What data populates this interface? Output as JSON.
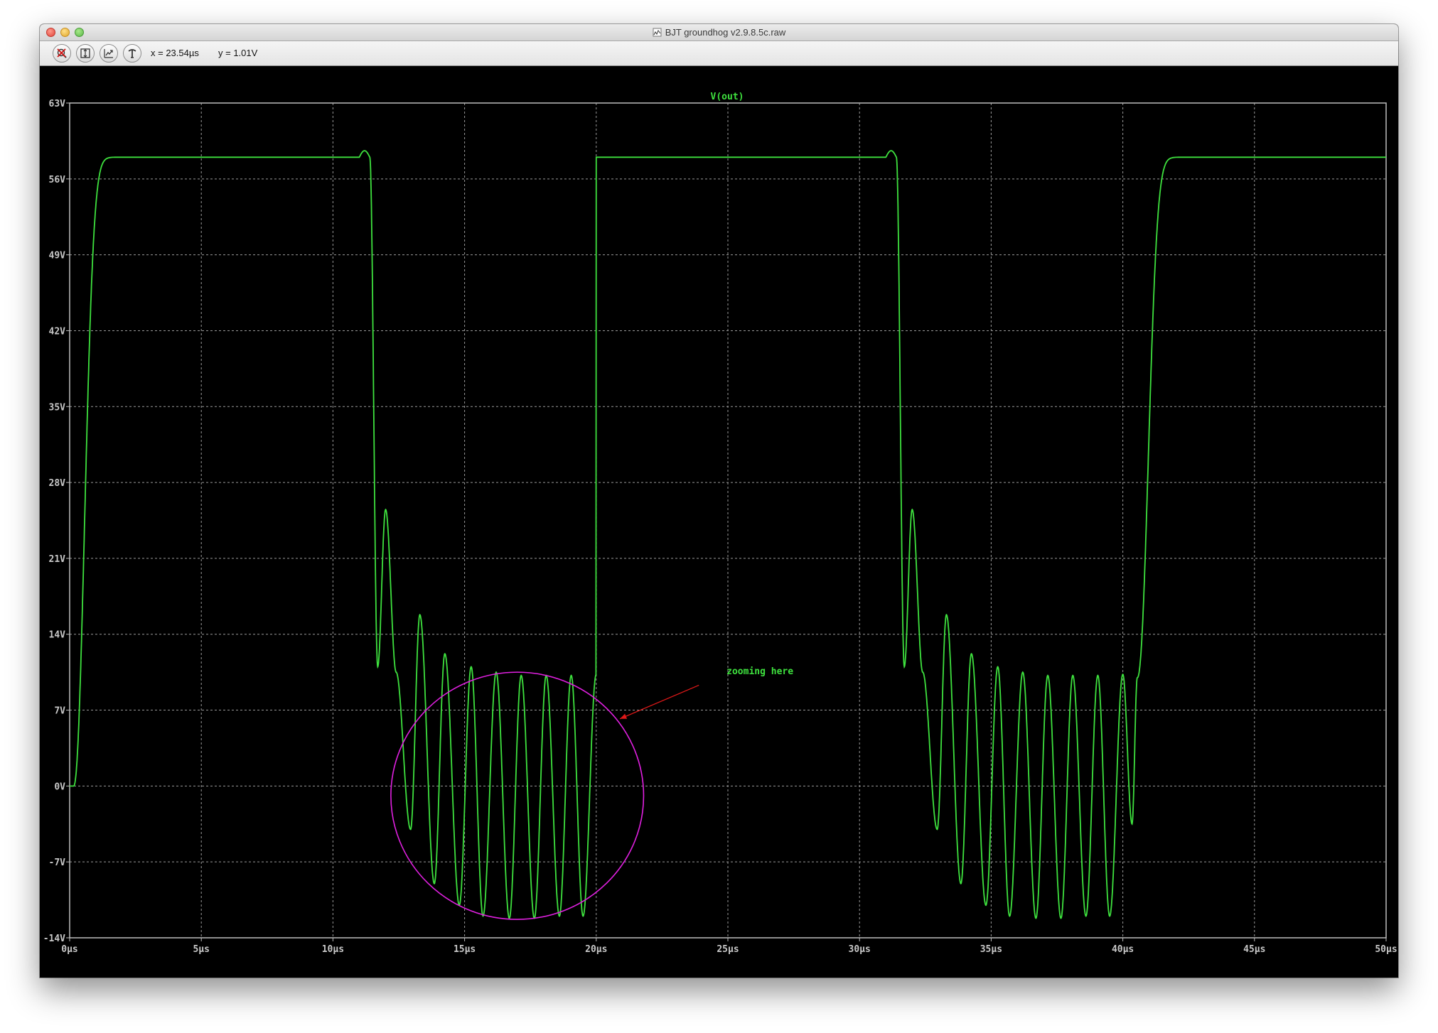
{
  "window": {
    "title": "BJT groundhog v2.9.8.5c.raw"
  },
  "toolbar": {
    "buttons": [
      {
        "name": "zoom-cancel-icon"
      },
      {
        "name": "zoom-fit-icon"
      },
      {
        "name": "zoom-back-icon"
      },
      {
        "name": "probe-icon"
      }
    ],
    "x_readout": "x = 23.54µs",
    "y_readout": "y = 1.01V"
  },
  "colors": {
    "trace": "#3ee13e",
    "grid": "#9a9a9a",
    "annotation_circle": "#e020e0",
    "arrow": "#e01818",
    "background": "#000000"
  },
  "annotation": {
    "text": "zooming here"
  },
  "chart_data": {
    "type": "line",
    "title": "V(out)",
    "series": [
      {
        "name": "V(out)"
      }
    ],
    "xlim": [
      0,
      50
    ],
    "ylim": [
      -14,
      63
    ],
    "xticks": [
      0,
      5,
      10,
      15,
      20,
      25,
      30,
      35,
      40,
      45,
      50
    ],
    "xtick_labels": [
      "0µs",
      "5µs",
      "10µs",
      "15µs",
      "20µs",
      "25µs",
      "30µs",
      "35µs",
      "40µs",
      "45µs",
      "50µs"
    ],
    "yticks": [
      63,
      56,
      49,
      42,
      35,
      28,
      21,
      14,
      7,
      0,
      -7,
      -14
    ],
    "ytick_labels": [
      "63V",
      "56V",
      "49V",
      "42V",
      "35V",
      "28V",
      "21V",
      "14V",
      "7V",
      "0V",
      "-7V",
      "-14V"
    ],
    "grid": true,
    "waveform": {
      "high_level": 58,
      "period": 20,
      "rise_start": 0.15,
      "fall_start": 11.4,
      "ringing_peaks": [
        [
          11.7,
          11
        ],
        [
          12.0,
          25.5
        ],
        [
          12.4,
          10.5
        ],
        [
          12.95,
          -4
        ],
        [
          13.3,
          15.8
        ],
        [
          13.85,
          -9
        ],
        [
          14.25,
          12.2
        ],
        [
          14.8,
          -11
        ],
        [
          15.25,
          11
        ],
        [
          15.7,
          -12
        ],
        [
          16.2,
          10.5
        ],
        [
          16.7,
          -12.2
        ],
        [
          17.15,
          10.2
        ],
        [
          17.65,
          -12.2
        ],
        [
          18.1,
          10.2
        ],
        [
          18.6,
          -12
        ],
        [
          19.05,
          10.2
        ],
        [
          19.5,
          -12
        ],
        [
          20.0,
          10.3
        ],
        [
          20.35,
          -3.5
        ],
        [
          20.55,
          10
        ]
      ],
      "rise2_start": 20.6
    }
  }
}
